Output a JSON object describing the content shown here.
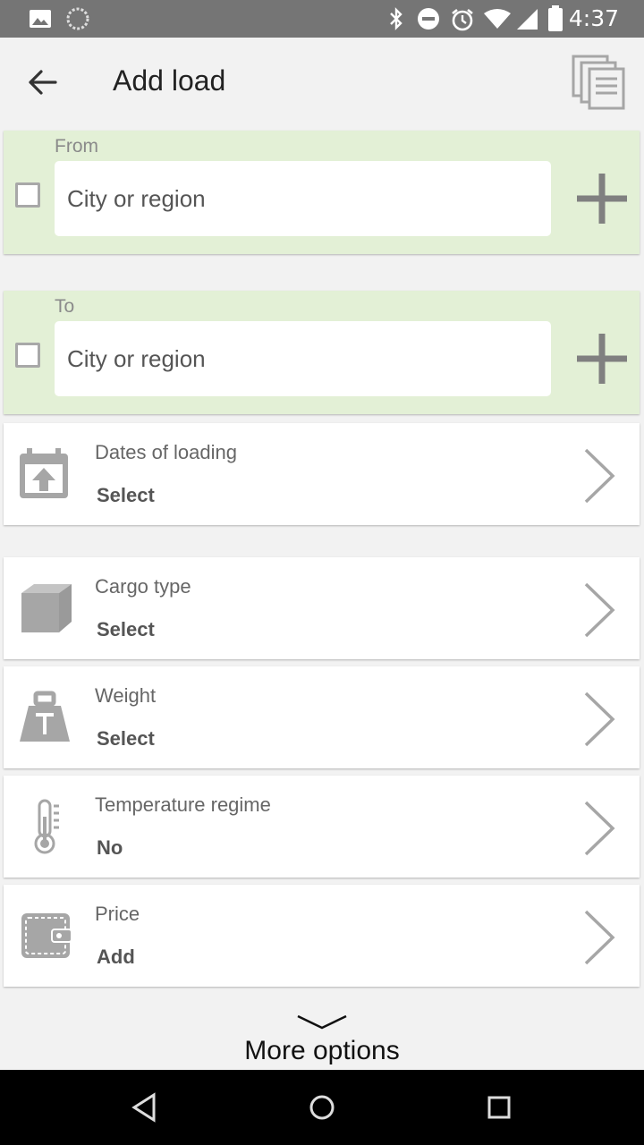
{
  "status_bar": {
    "time": "4:37"
  },
  "app_bar": {
    "title": "Add load"
  },
  "route": {
    "from": {
      "label": "From",
      "placeholder": "City or region"
    },
    "to": {
      "label": "To",
      "placeholder": "City or region"
    }
  },
  "options": {
    "dates": {
      "title": "Dates of loading",
      "value": "Select"
    },
    "cargo": {
      "title": "Cargo type",
      "value": "Select"
    },
    "weight": {
      "title": "Weight",
      "value": "Select"
    },
    "temperature": {
      "title": "Temperature regime",
      "value": "No"
    },
    "price": {
      "title": "Price",
      "value": "Add"
    }
  },
  "more_options": {
    "label": "More options"
  },
  "colors": {
    "route_background": "#e3f0d6",
    "icon_gray": "#a6a6a6",
    "status_bar": "#757575"
  }
}
